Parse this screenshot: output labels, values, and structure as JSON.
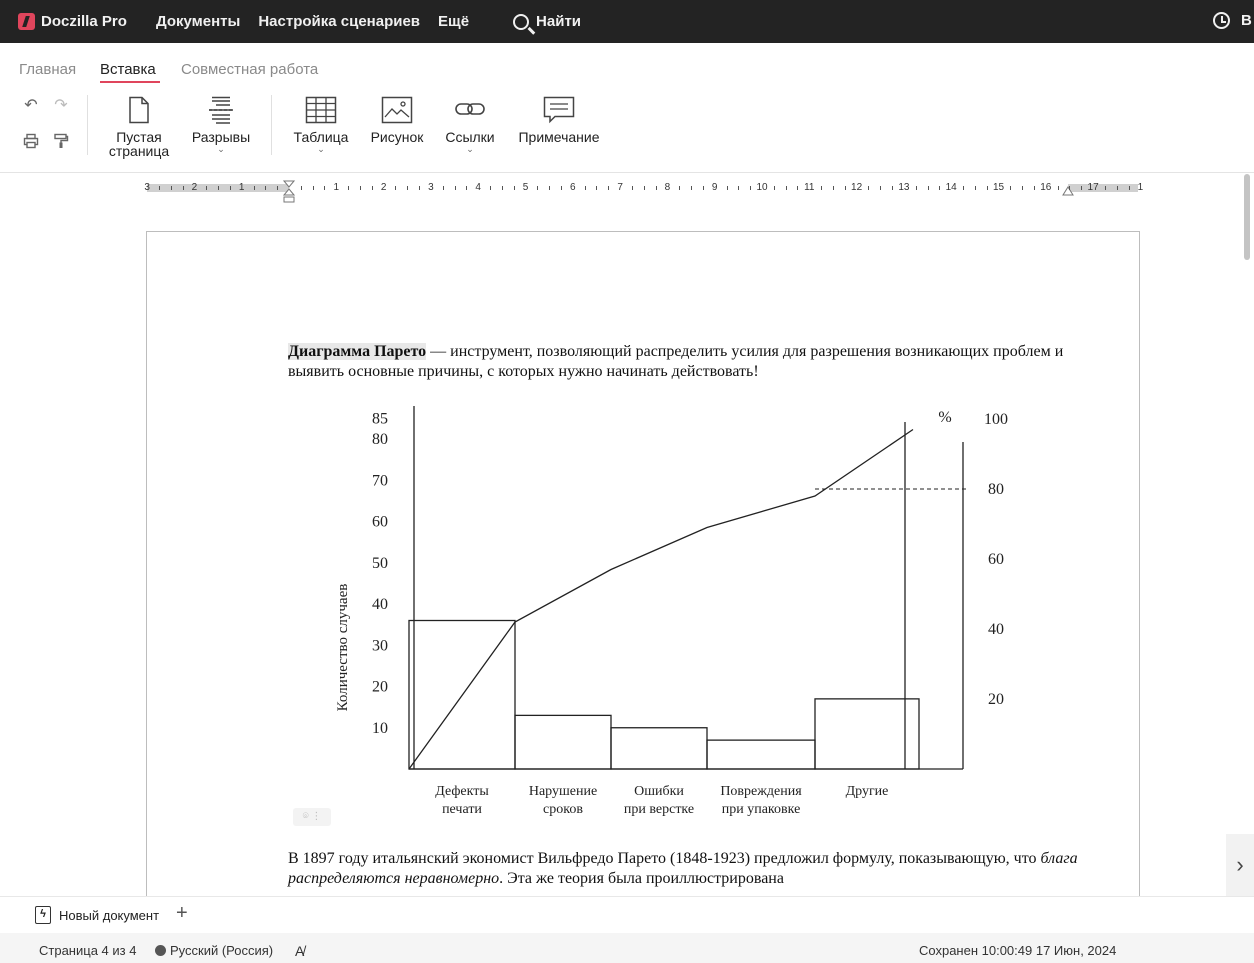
{
  "app": {
    "name": "Doczilla Pro"
  },
  "nav": {
    "items": [
      "Документы",
      "Настройка сценариев",
      "Ещё"
    ],
    "search_label": "Найти",
    "right_text": "В"
  },
  "tabs": [
    {
      "label": "Главная",
      "active": false
    },
    {
      "label": "Вставка",
      "active": true
    },
    {
      "label": "Совместная работа",
      "active": false
    }
  ],
  "toolbar": {
    "undo": "undo-icon",
    "redo": "redo-icon",
    "print": "print-icon",
    "format_painter": "format-painter-icon",
    "blank_page": {
      "line1": "Пустая",
      "line2": "страница"
    },
    "breaks": "Разрывы",
    "table": "Таблица",
    "picture": "Рисунок",
    "links": "Ссылки",
    "comment": "Примечание"
  },
  "ruler": {
    "left_labels": [
      "3",
      "2",
      "1"
    ],
    "right_labels": [
      "1",
      "2",
      "3",
      "4",
      "5",
      "6",
      "7",
      "8",
      "9",
      "10",
      "11",
      "12",
      "13",
      "14",
      "15",
      "16",
      "17",
      "1"
    ]
  },
  "document": {
    "p1_bold": "Диаграмма Парето",
    "p1_rest": " — инструмент, позволяющий распределить усилия для разрешения возникающих проблем и выявить основные причины, с которых нужно начинать действовать!",
    "p2_start": "В 1897 году итальянский экономист Вильфредо Парето (1848-1923) предложил формулу, показывающую, что ",
    "p2_italic": "блага распределяются неравномерно",
    "p2_end": ". Эта же теория была проиллюстрирована"
  },
  "chart_data": {
    "type": "bar",
    "ylabel": "Количество случаев",
    "y_ticks": [
      10,
      20,
      30,
      40,
      50,
      60,
      70,
      80,
      85
    ],
    "ylim": [
      0,
      88
    ],
    "y2_label": "%",
    "y2_ticks": [
      20,
      40,
      60,
      80,
      100
    ],
    "y2lim": [
      0,
      100
    ],
    "categories": [
      {
        "line1": "Дефекты",
        "line2": "печати"
      },
      {
        "line1": "Нарушение",
        "line2": "сроков"
      },
      {
        "line1": "Ошибки",
        "line2": "при верстке"
      },
      {
        "line1": "Повреждения",
        "line2": "при упаковке"
      },
      {
        "line1": "Другие",
        "line2": ""
      }
    ],
    "values": [
      36,
      13,
      10,
      7,
      17
    ],
    "cumulative_percent": [
      0,
      42,
      57,
      69,
      78,
      97
    ],
    "reference_percent": 80
  },
  "statusbar": {
    "doc_tab": "Новый документ",
    "page": "Страница 4 из 4",
    "language": "Русский (Россия)",
    "saved": "Сохранен 10:00:49 17 Июн, 2024"
  }
}
